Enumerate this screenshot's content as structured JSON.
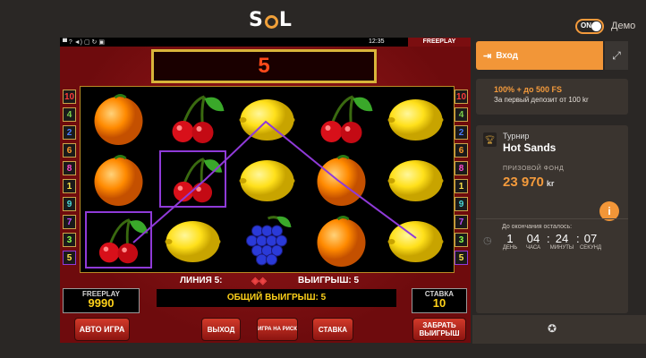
{
  "header": {
    "logo": "S",
    "logo_end": "L",
    "toggle_label": "ON",
    "demo_label": "Демо"
  },
  "game": {
    "status": {
      "icons": "▀ ? ◄) ▢ ↻ ▣",
      "time": "12:35",
      "freeplay": "FREEPLAY"
    },
    "line_display": "5",
    "line_numbers_left": [
      "10",
      "4",
      "2",
      "6",
      "8",
      "1",
      "9",
      "7",
      "3",
      "5"
    ],
    "line_numbers_right": [
      "10",
      "4",
      "2",
      "6",
      "8",
      "1",
      "9",
      "7",
      "3",
      "5"
    ],
    "line_colors": [
      "#ff3a3a",
      "#7bd04a",
      "#4a7bff",
      "#ff9a2a",
      "#ff4ad0",
      "#ffe24a",
      "#4ad8d8",
      "#c04aff",
      "#8aff4a",
      "#ffe24a"
    ],
    "reels": [
      [
        "orange",
        "orange",
        "cherries"
      ],
      [
        "cherries",
        "cherries",
        "lemon"
      ],
      [
        "lemon",
        "lemon",
        "grapes"
      ],
      [
        "cherries",
        "orange",
        "orange"
      ],
      [
        "lemon",
        "lemon",
        "lemon"
      ]
    ],
    "info_line": "ЛИНИЯ 5:",
    "info_win": "ВЫИГРЫШ: 5",
    "total_win": "ОБЩИЙ ВЫИГРЫШ: 5",
    "freeplay_box": {
      "label": "FREEPLAY",
      "value": "9990"
    },
    "stake_box": {
      "label": "СТАВКА",
      "value": "10"
    },
    "buttons": {
      "auto": "АВТО ИГРА",
      "exit": "ВЫХОД",
      "risk": "ИГРА НА РИСК",
      "stake": "СТАВКА",
      "collect": "ЗАБРАТЬ ВЫИГРЫШ"
    }
  },
  "panel": {
    "login": "Вход",
    "bonus_title": "100% + до 500 FS",
    "bonus_sub": "За первый депозит от 100 kr",
    "tournament_label": "Турнир",
    "tournament_name": "Hot Sands",
    "prize_label": "ПРИЗОВОЙ ФОНД",
    "prize_value": "23 970",
    "prize_currency": "kr",
    "countdown_label": "До окончания осталось:",
    "countdown": [
      {
        "n": "1",
        "u": "ДЕНЬ"
      },
      {
        "n": "04",
        "u": "ЧАСА"
      },
      {
        "n": "24",
        "u": "МИНУТЫ"
      },
      {
        "n": "07",
        "u": "СЕКУНД"
      }
    ]
  }
}
